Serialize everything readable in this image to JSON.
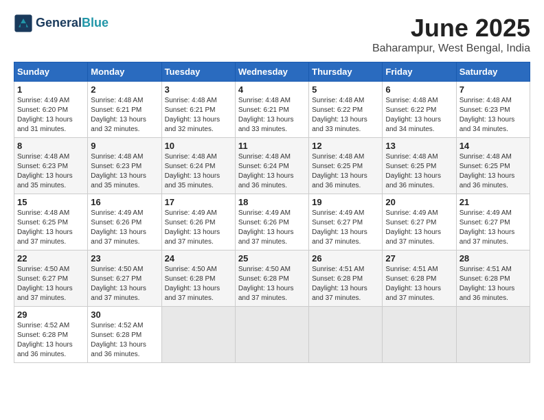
{
  "header": {
    "logo_line1": "General",
    "logo_line2": "Blue",
    "month_title": "June 2025",
    "location": "Baharampur, West Bengal, India"
  },
  "calendar": {
    "days_of_week": [
      "Sunday",
      "Monday",
      "Tuesday",
      "Wednesday",
      "Thursday",
      "Friday",
      "Saturday"
    ],
    "weeks": [
      [
        null,
        {
          "day": "2",
          "sunrise": "4:48 AM",
          "sunset": "6:21 PM",
          "daylight": "13 hours and 32 minutes."
        },
        {
          "day": "3",
          "sunrise": "4:48 AM",
          "sunset": "6:21 PM",
          "daylight": "13 hours and 32 minutes."
        },
        {
          "day": "4",
          "sunrise": "4:48 AM",
          "sunset": "6:21 PM",
          "daylight": "13 hours and 33 minutes."
        },
        {
          "day": "5",
          "sunrise": "4:48 AM",
          "sunset": "6:22 PM",
          "daylight": "13 hours and 33 minutes."
        },
        {
          "day": "6",
          "sunrise": "4:48 AM",
          "sunset": "6:22 PM",
          "daylight": "13 hours and 34 minutes."
        },
        {
          "day": "7",
          "sunrise": "4:48 AM",
          "sunset": "6:23 PM",
          "daylight": "13 hours and 34 minutes."
        }
      ],
      [
        {
          "day": "1",
          "sunrise": "4:49 AM",
          "sunset": "6:20 PM",
          "daylight": "13 hours and 31 minutes."
        },
        {
          "day": "9",
          "sunrise": "4:48 AM",
          "sunset": "6:23 PM",
          "daylight": "13 hours and 35 minutes."
        },
        {
          "day": "10",
          "sunrise": "4:48 AM",
          "sunset": "6:24 PM",
          "daylight": "13 hours and 35 minutes."
        },
        {
          "day": "11",
          "sunrise": "4:48 AM",
          "sunset": "6:24 PM",
          "daylight": "13 hours and 36 minutes."
        },
        {
          "day": "12",
          "sunrise": "4:48 AM",
          "sunset": "6:25 PM",
          "daylight": "13 hours and 36 minutes."
        },
        {
          "day": "13",
          "sunrise": "4:48 AM",
          "sunset": "6:25 PM",
          "daylight": "13 hours and 36 minutes."
        },
        {
          "day": "14",
          "sunrise": "4:48 AM",
          "sunset": "6:25 PM",
          "daylight": "13 hours and 36 minutes."
        }
      ],
      [
        {
          "day": "8",
          "sunrise": "4:48 AM",
          "sunset": "6:23 PM",
          "daylight": "13 hours and 35 minutes."
        },
        {
          "day": "16",
          "sunrise": "4:49 AM",
          "sunset": "6:26 PM",
          "daylight": "13 hours and 37 minutes."
        },
        {
          "day": "17",
          "sunrise": "4:49 AM",
          "sunset": "6:26 PM",
          "daylight": "13 hours and 37 minutes."
        },
        {
          "day": "18",
          "sunrise": "4:49 AM",
          "sunset": "6:26 PM",
          "daylight": "13 hours and 37 minutes."
        },
        {
          "day": "19",
          "sunrise": "4:49 AM",
          "sunset": "6:27 PM",
          "daylight": "13 hours and 37 minutes."
        },
        {
          "day": "20",
          "sunrise": "4:49 AM",
          "sunset": "6:27 PM",
          "daylight": "13 hours and 37 minutes."
        },
        {
          "day": "21",
          "sunrise": "4:49 AM",
          "sunset": "6:27 PM",
          "daylight": "13 hours and 37 minutes."
        }
      ],
      [
        {
          "day": "15",
          "sunrise": "4:48 AM",
          "sunset": "6:25 PM",
          "daylight": "13 hours and 37 minutes."
        },
        {
          "day": "23",
          "sunrise": "4:50 AM",
          "sunset": "6:27 PM",
          "daylight": "13 hours and 37 minutes."
        },
        {
          "day": "24",
          "sunrise": "4:50 AM",
          "sunset": "6:28 PM",
          "daylight": "13 hours and 37 minutes."
        },
        {
          "day": "25",
          "sunrise": "4:50 AM",
          "sunset": "6:28 PM",
          "daylight": "13 hours and 37 minutes."
        },
        {
          "day": "26",
          "sunrise": "4:51 AM",
          "sunset": "6:28 PM",
          "daylight": "13 hours and 37 minutes."
        },
        {
          "day": "27",
          "sunrise": "4:51 AM",
          "sunset": "6:28 PM",
          "daylight": "13 hours and 37 minutes."
        },
        {
          "day": "28",
          "sunrise": "4:51 AM",
          "sunset": "6:28 PM",
          "daylight": "13 hours and 36 minutes."
        }
      ],
      [
        {
          "day": "22",
          "sunrise": "4:50 AM",
          "sunset": "6:27 PM",
          "daylight": "13 hours and 37 minutes."
        },
        {
          "day": "30",
          "sunrise": "4:52 AM",
          "sunset": "6:28 PM",
          "daylight": "13 hours and 36 minutes."
        },
        null,
        null,
        null,
        null,
        null
      ],
      [
        {
          "day": "29",
          "sunrise": "4:52 AM",
          "sunset": "6:28 PM",
          "daylight": "13 hours and 36 minutes."
        },
        null,
        null,
        null,
        null,
        null,
        null
      ]
    ]
  }
}
